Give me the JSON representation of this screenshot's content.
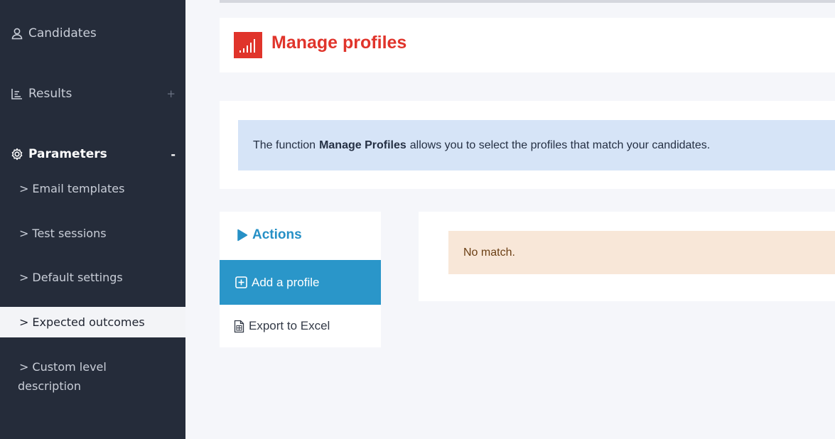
{
  "sidebar": {
    "candidates": {
      "label": "Candidates",
      "icon": "user-icon"
    },
    "results": {
      "label": "Results",
      "icon": "bar-chart-icon",
      "toggle": "+"
    },
    "parameters": {
      "label": "Parameters",
      "icon": "gear-icon",
      "toggle": "-",
      "items": [
        {
          "label": "Email templates"
        },
        {
          "label": "Test sessions"
        },
        {
          "label": "Default settings"
        },
        {
          "label": "Expected outcomes",
          "active": true
        },
        {
          "label_line1": "Custom level",
          "label_line2": "description"
        }
      ]
    },
    "chevron": ">"
  },
  "header": {
    "title": "Manage profiles",
    "logo_icon": "signal-bars-icon",
    "accent": "#e0342b"
  },
  "info": {
    "prefix": "The function",
    "bold": "Manage Profiles",
    "suffix": "allows you to select the profiles that match your candidates."
  },
  "actions": {
    "title": "Actions",
    "title_icon": "play-icon",
    "add_label": "Add a profile",
    "add_icon": "plus-square-icon",
    "export_label": "Export to Excel",
    "export_icon": "spreadsheet-file-icon",
    "accent": "#2a96c9"
  },
  "results": {
    "message": "No match."
  }
}
